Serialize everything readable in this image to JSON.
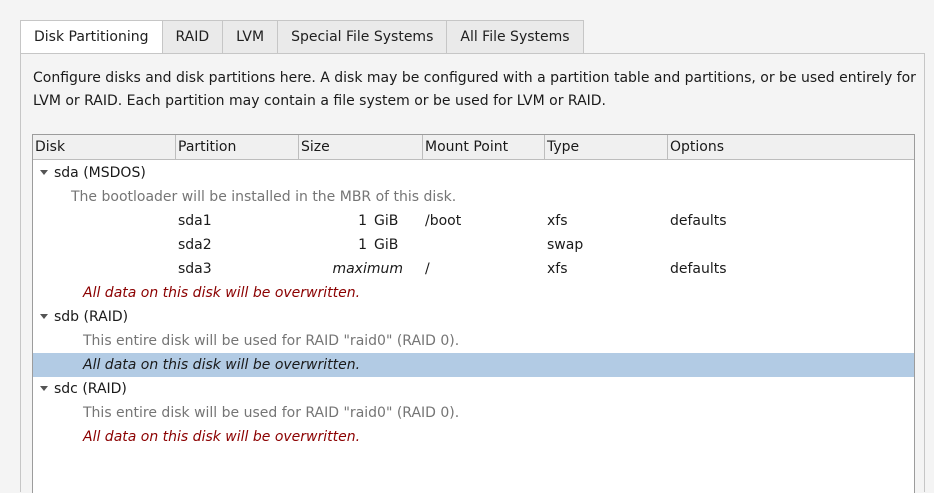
{
  "tabs": [
    {
      "label": "Disk Partitioning",
      "active": true
    },
    {
      "label": "RAID",
      "active": false
    },
    {
      "label": "LVM",
      "active": false
    },
    {
      "label": "Special File Systems",
      "active": false
    },
    {
      "label": "All File Systems",
      "active": false
    }
  ],
  "description": "Configure disks and disk partitions here.  A disk may be configured with a partition table and partitions, or be used entirely for LVM or RAID.  Each partition may contain a file system or be used for LVM or RAID.",
  "columns": [
    "Disk",
    "Partition",
    "Size",
    "Mount Point",
    "Type",
    "Options"
  ],
  "rows": {
    "sda": {
      "label": "sda (MSDOS)",
      "note": "The bootloader will be installed in the MBR of this disk.",
      "partitions": [
        {
          "name": "sda1",
          "size_num": "1",
          "size_unit": "GiB",
          "mount": "/boot",
          "type": "xfs",
          "options": "defaults"
        },
        {
          "name": "sda2",
          "size_num": "1",
          "size_unit": "GiB",
          "mount": "",
          "type": "swap",
          "options": ""
        },
        {
          "name": "sda3",
          "size_text": "maximum",
          "mount": "/",
          "type": "xfs",
          "options": "defaults"
        }
      ],
      "warning": "All data on this disk will be overwritten."
    },
    "sdb": {
      "label": "sdb (RAID)",
      "note": "This entire disk will be used for RAID \"raid0\" (RAID 0).",
      "warning": "All data on this disk will be overwritten."
    },
    "sdc": {
      "label": "sdc (RAID)",
      "note": "This entire disk will be used for RAID \"raid0\" (RAID 0).",
      "warning": "All data on this disk will be overwritten."
    }
  },
  "colors": {
    "selected_row": "#b2cbe4",
    "warning_text": "#8b0000",
    "note_text": "#757575"
  }
}
